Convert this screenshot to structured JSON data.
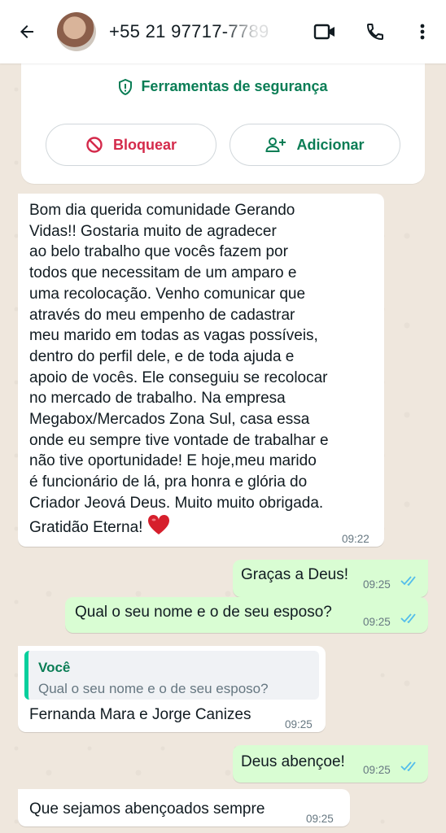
{
  "header": {
    "contact_number": "+55 21 97717-7789",
    "icons": [
      "back-arrow-icon",
      "avatar",
      "video-call-icon",
      "phone-icon",
      "more-vert-icon"
    ]
  },
  "security_card": {
    "tools_label": "Ferramentas de segurança",
    "block_label": "Bloquear",
    "add_label": "Adicionar",
    "colors": {
      "green": "#0a7d55",
      "red": "#d42a4b"
    }
  },
  "messages": [
    {
      "direction": "in",
      "text": "Bom dia querida comunidade Gerando\nVidas!! Gostaria muito de agradecer\nao belo trabalho que vocês fazem por\ntodos que necessitam de um amparo e\numa recolocação. Venho comunicar que\natravés do meu empenho de cadastrar\nmeu marido em todas as vagas possíveis,\ndentro do perfil dele, e de toda ajuda e\napoio de vocês.  Ele conseguiu se recolocar\nno mercado de trabalho.  Na empresa\nMegabox/Mercados Zona Sul, casa essa\nonde eu sempre tive vontade de trabalhar e\nnão tive oportunidade! E hoje,meu marido\né funcionário de lá,  pra honra e glória do\nCriador Jeová Deus. Muito muito obrigada.\nGratidão Eterna!",
      "emoji": "red-heart",
      "time": "09:22"
    },
    {
      "direction": "out",
      "text": "Graças a Deus!",
      "time": "09:25",
      "status": "read"
    },
    {
      "direction": "out",
      "text": "Qual o seu nome e o de seu esposo?",
      "time": "09:25",
      "status": "read"
    },
    {
      "direction": "in",
      "quote_author": "Você",
      "quote_text": "Qual o seu nome e o de seu esposo?",
      "text": "Fernanda Mara e Jorge Canizes",
      "time": "09:25"
    },
    {
      "direction": "out",
      "text": "Deus abençoe!",
      "time": "09:25",
      "status": "read"
    },
    {
      "direction": "in",
      "text": "Que sejamos abençoados sempre",
      "time": "09:25"
    }
  ],
  "colors": {
    "outgoing_bubble": "#d9fdd3",
    "incoming_bubble": "#ffffff",
    "read_ticks": "#53bdeb",
    "chat_bg": "#efeae2"
  }
}
